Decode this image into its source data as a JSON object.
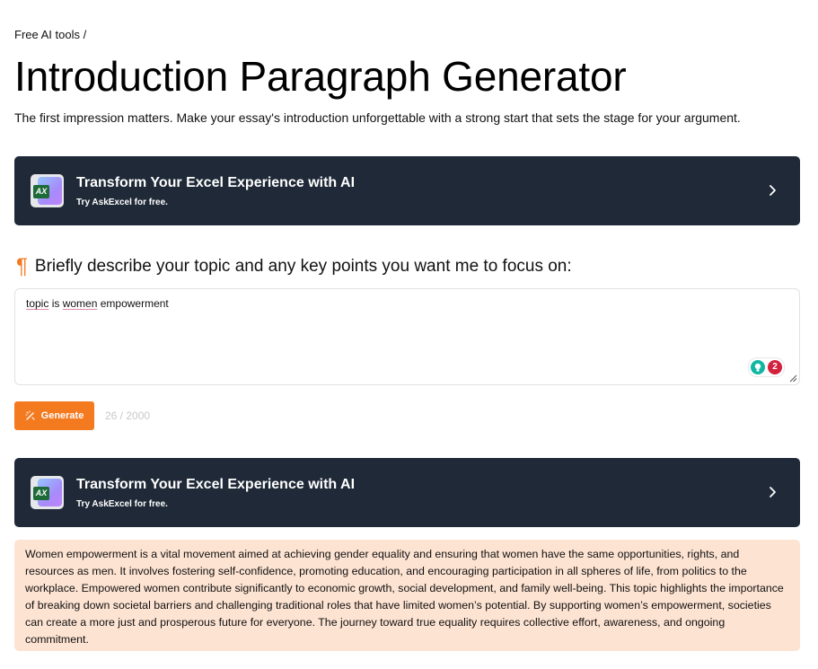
{
  "breadcrumb": "Free AI tools /",
  "title": "Introduction Paragraph Generator",
  "subtitle": "The first impression matters. Make your essay's introduction unforgettable with a strong start that sets the stage for your argument.",
  "promo": {
    "logo_text": "AX",
    "title": "Transform Your Excel Experience with AI",
    "subtitle": "Try AskExcel for free."
  },
  "prompt": {
    "label": "Briefly describe your topic and any key points you want me to focus on:",
    "value_words": [
      "topic",
      " is ",
      "women",
      " empowerment"
    ],
    "error_count": "2"
  },
  "generate": {
    "label": "Generate",
    "char_count": "26 / 2000"
  },
  "result": {
    "text": "Women empowerment is a vital movement aimed at achieving gender equality and ensuring that women have the same opportunities, rights, and resources as men. It involves fostering self-confidence, promoting education, and encouraging participation in all spheres of life, from politics to the workplace. Empowered women contribute significantly to economic growth, social development, and family well-being. This topic highlights the importance of breaking down societal barriers and challenging traditional roles that have limited women’s potential. By supporting women’s empowerment, societies can create a more just and prosperous future for everyone. The journey toward true equality requires collective effort, awareness, and ongoing commitment."
  },
  "colors": {
    "accent": "#f47a20",
    "banner_bg": "#1f2937",
    "result_bg": "#fde3d2",
    "error_badge": "#d4213d",
    "assist_icon": "#10b7a3"
  }
}
